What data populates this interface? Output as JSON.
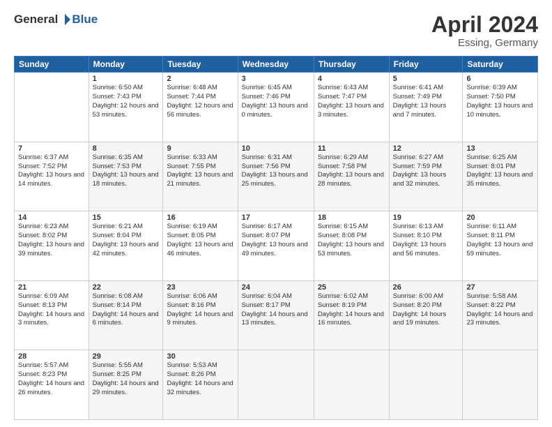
{
  "header": {
    "logo": {
      "general": "General",
      "blue": "Blue"
    },
    "title": "April 2024",
    "location": "Essing, Germany"
  },
  "weekdays": [
    "Sunday",
    "Monday",
    "Tuesday",
    "Wednesday",
    "Thursday",
    "Friday",
    "Saturday"
  ],
  "weeks": [
    [
      {
        "day": "",
        "sunrise": "",
        "sunset": "",
        "daylight": ""
      },
      {
        "day": "1",
        "sunrise": "Sunrise: 6:50 AM",
        "sunset": "Sunset: 7:43 PM",
        "daylight": "Daylight: 12 hours and 53 minutes."
      },
      {
        "day": "2",
        "sunrise": "Sunrise: 6:48 AM",
        "sunset": "Sunset: 7:44 PM",
        "daylight": "Daylight: 12 hours and 56 minutes."
      },
      {
        "day": "3",
        "sunrise": "Sunrise: 6:45 AM",
        "sunset": "Sunset: 7:46 PM",
        "daylight": "Daylight: 13 hours and 0 minutes."
      },
      {
        "day": "4",
        "sunrise": "Sunrise: 6:43 AM",
        "sunset": "Sunset: 7:47 PM",
        "daylight": "Daylight: 13 hours and 3 minutes."
      },
      {
        "day": "5",
        "sunrise": "Sunrise: 6:41 AM",
        "sunset": "Sunset: 7:49 PM",
        "daylight": "Daylight: 13 hours and 7 minutes."
      },
      {
        "day": "6",
        "sunrise": "Sunrise: 6:39 AM",
        "sunset": "Sunset: 7:50 PM",
        "daylight": "Daylight: 13 hours and 10 minutes."
      }
    ],
    [
      {
        "day": "7",
        "sunrise": "Sunrise: 6:37 AM",
        "sunset": "Sunset: 7:52 PM",
        "daylight": "Daylight: 13 hours and 14 minutes."
      },
      {
        "day": "8",
        "sunrise": "Sunrise: 6:35 AM",
        "sunset": "Sunset: 7:53 PM",
        "daylight": "Daylight: 13 hours and 18 minutes."
      },
      {
        "day": "9",
        "sunrise": "Sunrise: 6:33 AM",
        "sunset": "Sunset: 7:55 PM",
        "daylight": "Daylight: 13 hours and 21 minutes."
      },
      {
        "day": "10",
        "sunrise": "Sunrise: 6:31 AM",
        "sunset": "Sunset: 7:56 PM",
        "daylight": "Daylight: 13 hours and 25 minutes."
      },
      {
        "day": "11",
        "sunrise": "Sunrise: 6:29 AM",
        "sunset": "Sunset: 7:58 PM",
        "daylight": "Daylight: 13 hours and 28 minutes."
      },
      {
        "day": "12",
        "sunrise": "Sunrise: 6:27 AM",
        "sunset": "Sunset: 7:59 PM",
        "daylight": "Daylight: 13 hours and 32 minutes."
      },
      {
        "day": "13",
        "sunrise": "Sunrise: 6:25 AM",
        "sunset": "Sunset: 8:01 PM",
        "daylight": "Daylight: 13 hours and 35 minutes."
      }
    ],
    [
      {
        "day": "14",
        "sunrise": "Sunrise: 6:23 AM",
        "sunset": "Sunset: 8:02 PM",
        "daylight": "Daylight: 13 hours and 39 minutes."
      },
      {
        "day": "15",
        "sunrise": "Sunrise: 6:21 AM",
        "sunset": "Sunset: 8:04 PM",
        "daylight": "Daylight: 13 hours and 42 minutes."
      },
      {
        "day": "16",
        "sunrise": "Sunrise: 6:19 AM",
        "sunset": "Sunset: 8:05 PM",
        "daylight": "Daylight: 13 hours and 46 minutes."
      },
      {
        "day": "17",
        "sunrise": "Sunrise: 6:17 AM",
        "sunset": "Sunset: 8:07 PM",
        "daylight": "Daylight: 13 hours and 49 minutes."
      },
      {
        "day": "18",
        "sunrise": "Sunrise: 6:15 AM",
        "sunset": "Sunset: 8:08 PM",
        "daylight": "Daylight: 13 hours and 53 minutes."
      },
      {
        "day": "19",
        "sunrise": "Sunrise: 6:13 AM",
        "sunset": "Sunset: 8:10 PM",
        "daylight": "Daylight: 13 hours and 56 minutes."
      },
      {
        "day": "20",
        "sunrise": "Sunrise: 6:11 AM",
        "sunset": "Sunset: 8:11 PM",
        "daylight": "Daylight: 13 hours and 59 minutes."
      }
    ],
    [
      {
        "day": "21",
        "sunrise": "Sunrise: 6:09 AM",
        "sunset": "Sunset: 8:13 PM",
        "daylight": "Daylight: 14 hours and 3 minutes."
      },
      {
        "day": "22",
        "sunrise": "Sunrise: 6:08 AM",
        "sunset": "Sunset: 8:14 PM",
        "daylight": "Daylight: 14 hours and 6 minutes."
      },
      {
        "day": "23",
        "sunrise": "Sunrise: 6:06 AM",
        "sunset": "Sunset: 8:16 PM",
        "daylight": "Daylight: 14 hours and 9 minutes."
      },
      {
        "day": "24",
        "sunrise": "Sunrise: 6:04 AM",
        "sunset": "Sunset: 8:17 PM",
        "daylight": "Daylight: 14 hours and 13 minutes."
      },
      {
        "day": "25",
        "sunrise": "Sunrise: 6:02 AM",
        "sunset": "Sunset: 8:19 PM",
        "daylight": "Daylight: 14 hours and 16 minutes."
      },
      {
        "day": "26",
        "sunrise": "Sunrise: 6:00 AM",
        "sunset": "Sunset: 8:20 PM",
        "daylight": "Daylight: 14 hours and 19 minutes."
      },
      {
        "day": "27",
        "sunrise": "Sunrise: 5:58 AM",
        "sunset": "Sunset: 8:22 PM",
        "daylight": "Daylight: 14 hours and 23 minutes."
      }
    ],
    [
      {
        "day": "28",
        "sunrise": "Sunrise: 5:57 AM",
        "sunset": "Sunset: 8:23 PM",
        "daylight": "Daylight: 14 hours and 26 minutes."
      },
      {
        "day": "29",
        "sunrise": "Sunrise: 5:55 AM",
        "sunset": "Sunset: 8:25 PM",
        "daylight": "Daylight: 14 hours and 29 minutes."
      },
      {
        "day": "30",
        "sunrise": "Sunrise: 5:53 AM",
        "sunset": "Sunset: 8:26 PM",
        "daylight": "Daylight: 14 hours and 32 minutes."
      },
      {
        "day": "",
        "sunrise": "",
        "sunset": "",
        "daylight": ""
      },
      {
        "day": "",
        "sunrise": "",
        "sunset": "",
        "daylight": ""
      },
      {
        "day": "",
        "sunrise": "",
        "sunset": "",
        "daylight": ""
      },
      {
        "day": "",
        "sunrise": "",
        "sunset": "",
        "daylight": ""
      }
    ]
  ]
}
